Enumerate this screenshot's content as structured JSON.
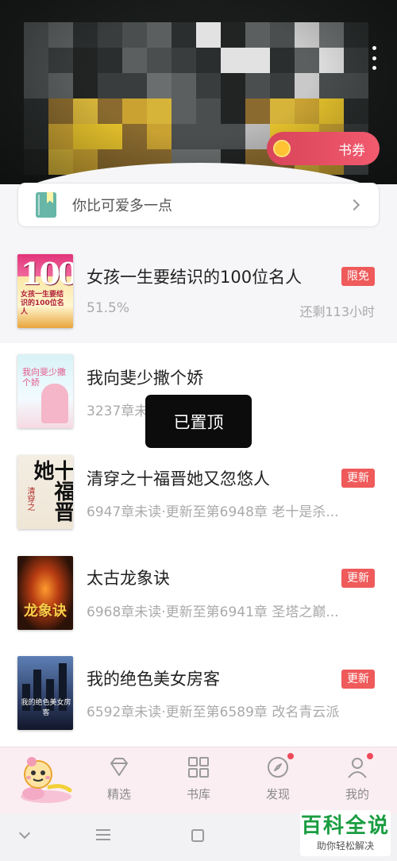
{
  "header": {
    "coupon_label": "书券",
    "more_icon": "more-vertical-icon"
  },
  "reminder": {
    "text": "你比可爱多一点",
    "icon": "book-icon"
  },
  "books": [
    {
      "title": "女孩一生要结识的100位名人",
      "subtitle": "51.5%",
      "badge": "限免",
      "extra": "还剩113小时",
      "cover_text_big": "100",
      "cover_text": "女孩一生要结识的100位名人"
    },
    {
      "title": "我向斐少撒个娇",
      "subtitle": "3237章未",
      "cover_text": "我向斐少撒个娇"
    },
    {
      "title": "清穿之十福晋她又忽悠人",
      "subtitle": "6947章未读·更新至第6948章 老十是杀...",
      "badge": "更新",
      "cover_text": "十福晋她",
      "cover_sub": "清穿之"
    },
    {
      "title": "太古龙象诀",
      "subtitle": "6968章未读·更新至第6941章 圣塔之巅...",
      "badge": "更新",
      "cover_text": "龙象诀"
    },
    {
      "title": "我的绝色美女房客",
      "subtitle": "6592章未读·更新至第6589章 改名青云派",
      "badge": "更新",
      "cover_text": "我的绝色美女房客"
    }
  ],
  "toast": "已置顶",
  "bottom_nav": [
    {
      "label": "精选",
      "icon": "diamond-icon",
      "dot": false
    },
    {
      "label": "书库",
      "icon": "grid-icon",
      "dot": false
    },
    {
      "label": "发现",
      "icon": "compass-icon",
      "dot": true
    },
    {
      "label": "我的",
      "icon": "profile-icon",
      "dot": true
    }
  ],
  "watermark": {
    "title": "百科全说",
    "subtitle": "助你轻松解决"
  },
  "colors": {
    "accent": "#ef5a5a",
    "nav_bg": "#fbeef2",
    "coupon_gradient_start": "#d8445a",
    "coupon_gradient_end": "#f25a6e"
  }
}
